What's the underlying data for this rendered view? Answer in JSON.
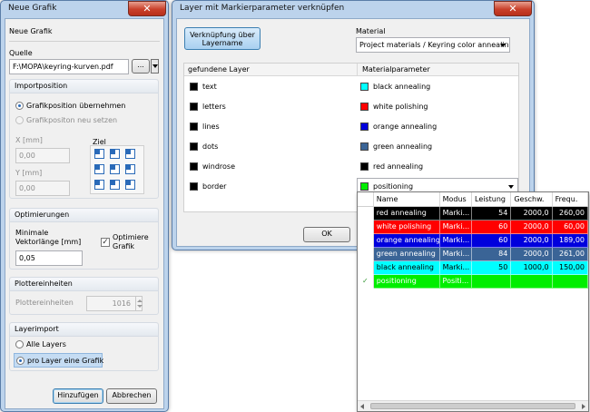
{
  "neue_grafik": {
    "title": "Neue Grafik",
    "close_glyph": "✕",
    "header": "Neue Grafik",
    "quelle_label": "Quelle",
    "quelle_value": "F:\\MOPA\\keyring-kurven.pdf",
    "browse_label": "...",
    "import_group": "Importposition",
    "radio_uebernehmen": "Grafikposition übernehmen",
    "radio_neu": "Grafikpositon neu setzen",
    "ziel_label": "Ziel",
    "x_label": "X [mm]",
    "x_value": "0,00",
    "y_label": "Y [mm]",
    "y_value": "0,00",
    "optim_group": "Optimierungen",
    "min_vec_label": "Minimale Vektorlänge [mm]",
    "min_vec_value": "0,05",
    "optimiere_label": "Optimiere Grafik",
    "optimiere_checked": true,
    "plotter_group": "Plottereinheiten",
    "plotter_label": "Plottereinheiten",
    "plotter_value": "1016",
    "layerimport_group": "Layerimport",
    "radio_alle": "Alle Layers",
    "radio_pro_layer": "pro Layer eine Grafik",
    "add_button": "Hinzufügen",
    "cancel_button": "Abbrechen"
  },
  "layer_dialog": {
    "title": "Layer mit Markierparameter verknüpfen",
    "close_glyph": "✕",
    "link_button": "Verknüpfung über Layername",
    "material_label": "Material",
    "material_value": "Project materials / Keyring color annealing",
    "col_layer": "gefundene Layer",
    "col_param": "Materialparameter",
    "rows": [
      {
        "layer": "text",
        "param": "black annealing",
        "color": "#00ffff"
      },
      {
        "layer": "letters",
        "param": "white polishing",
        "color": "#ff0000"
      },
      {
        "layer": "lines",
        "param": "orange annealing",
        "color": "#0000dd"
      },
      {
        "layer": "dots",
        "param": "green annealing",
        "color": "#3a6496"
      },
      {
        "layer": "windrose",
        "param": "red annealing",
        "color": "#000000"
      },
      {
        "layer": "border",
        "param": "positioning",
        "color": "#00ee00"
      }
    ],
    "ok_button": "OK"
  },
  "popup": {
    "headers": [
      "Name",
      "Modus",
      "Leistung",
      "Geschw.",
      "Frequ."
    ],
    "rows": [
      {
        "name": "red annealing",
        "modus": "Marki...",
        "leistung": "54",
        "geschw": "2000,0",
        "frequ": "260,00",
        "bg": "#000000",
        "fg": "#ffffff"
      },
      {
        "name": "white polishing",
        "modus": "Marki...",
        "leistung": "60",
        "geschw": "2000,0",
        "frequ": "60,00",
        "bg": "#ff0000",
        "fg": "#ffffff"
      },
      {
        "name": "orange annealing",
        "modus": "Marki...",
        "leistung": "60",
        "geschw": "2000,0",
        "frequ": "189,00",
        "bg": "#0000dd",
        "fg": "#ffffff"
      },
      {
        "name": "green annealing",
        "modus": "Marki...",
        "leistung": "84",
        "geschw": "2000,0",
        "frequ": "261,00",
        "bg": "#3a6496",
        "fg": "#ffffff"
      },
      {
        "name": "black annealing",
        "modus": "Marki...",
        "leistung": "50",
        "geschw": "1000,0",
        "frequ": "150,00",
        "bg": "#00ffff",
        "fg": "#000000"
      },
      {
        "name": "positioning",
        "modus": "Positi...",
        "leistung": "",
        "geschw": "",
        "frequ": "",
        "bg": "#00ee00",
        "fg": "#ffffff"
      }
    ]
  }
}
